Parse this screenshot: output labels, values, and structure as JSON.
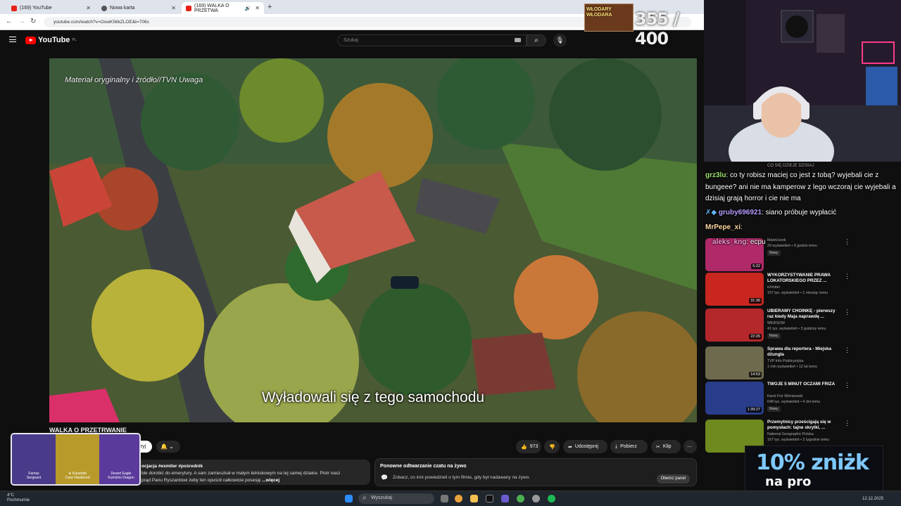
{
  "browser": {
    "tabs": [
      {
        "label": "(169) YouTube"
      },
      {
        "label": "Nowa karta"
      },
      {
        "label": "(169) WALKA O PRZETWA"
      }
    ],
    "url": "youtube.com/watch?v=OowK56kZLOE&t=706s"
  },
  "youtube": {
    "logo": "YouTube",
    "region": "PL",
    "search_placeholder": "Szukaj"
  },
  "video": {
    "watermark": "Materiał oryginalny i źródło//TVN Uwaga",
    "subtitle": "Wyładowali się z tego samochodu",
    "title": "WALKA O PRZETRWANIE",
    "subscribe_label": "zyj",
    "likes": "973",
    "share_label": "Udostępnij",
    "download_label": "Pobierz",
    "clip_label": "Klip",
    "description_line1": "ocjacja #exmiter #pośrednik",
    "description_line2": "ble dorobić do emerytury. A sam zamieszkał w małym letniskowym na tej samej działce. Piotr nasz",
    "description_line3": "prąd Panu Ryszardowi żeby ten opuścił całkowicie posesję",
    "more_label": "...więcej"
  },
  "chat_replay": {
    "heading": "Ponowne odtwarzanie czatu na żywo",
    "text": "Zobacz, co inni powiedzieli o tym filmie, gdy był nadawany na żywo.",
    "button": "Otwórz panel"
  },
  "recommendations": [
    {
      "title": "",
      "channel": "MateUszek",
      "views": "29 wyświetleń • 9 godzin temu",
      "badge": "Nowy",
      "duration": "5:22",
      "color": "#b02a6a"
    },
    {
      "title": "WYKORZYSTYWANIE PRAWA LOKATORSKIEGO PRZEZ ...",
      "channel": "eXmiter",
      "views": "157 tys. wyświetleń • 1 miesiąc temu",
      "badge": "",
      "duration": "31:36",
      "color": "#c8261f"
    },
    {
      "title": "UBIERAMY CHOINKĘ - pierwszy raz kiedy Maja naprawdę ...",
      "channel": "WERSOW",
      "views": "41 tys. wyświetleń • 3 godziny temu",
      "badge": "Nowy",
      "duration": "22:26",
      "color": "#b4282c"
    },
    {
      "title": "Sprawa dla reportera - Miejska dżungla",
      "channel": "TVP Info Publicystyka",
      "views": "1 mln wyświetleń • 12 lat temu",
      "badge": "",
      "duration": "14:53",
      "color": "#6e6a4d"
    },
    {
      "title": "TWOJE 5 MINUT OCZAMI FRIZA",
      "channel": "Karol Friz Wiśniewski",
      "views": "648 tys. wyświetleń • 4 dni temu",
      "badge": "Nowy",
      "duration": "1:39:27",
      "color": "#2a3d8a"
    },
    {
      "title": "Przemytnicy prześcigają się w pomysłach: tajne skrytki, ...",
      "channel": "National Geographic Polska",
      "views": "167 tys. wyświetleń • 2 tygodnie temu",
      "badge": "",
      "duration": "",
      "color": "#6f8a1e"
    }
  ],
  "stream": {
    "counter_caption": "WŁODARY WŁODARA",
    "counter": "355 / 400",
    "chat_header": "CO SIĘ DZIEJE DZISIAJ",
    "chat": [
      {
        "user": "grz3lu",
        "text": ": co ty robisz maciej co jest z tobą? wyjebali cie z bungeee? ani nie ma kamperow z lego wczoraj cie wyjebali a dzisiaj grają horror i cie nie ma",
        "color": "#9be36b"
      },
      {
        "user": "gruby696921",
        "text": ": siano próbuje wypłacić",
        "color": "#b69cff"
      },
      {
        "user": "MrPepe_xi",
        "text": ":",
        "color": "#ffd7a0"
      },
      {
        "user": "aleks_kng",
        "text": ": ecpu",
        "color": "#ff9ad5"
      }
    ],
    "promo_line1": "10% zniżk",
    "promo_line2": "na pro",
    "case_items": [
      {
        "name": "Famas",
        "sub": "Sergeant"
      },
      {
        "name": "★ Karambit",
        "sub": "Case Hardened"
      },
      {
        "name": "Desert Eagle",
        "sub": "Kumicho Dragon"
      }
    ]
  },
  "taskbar": {
    "weather_temp": "4°C",
    "weather_desc": "Pochmurnie",
    "search_placeholder": "Wyszukaj",
    "date": "12.12.2025"
  }
}
